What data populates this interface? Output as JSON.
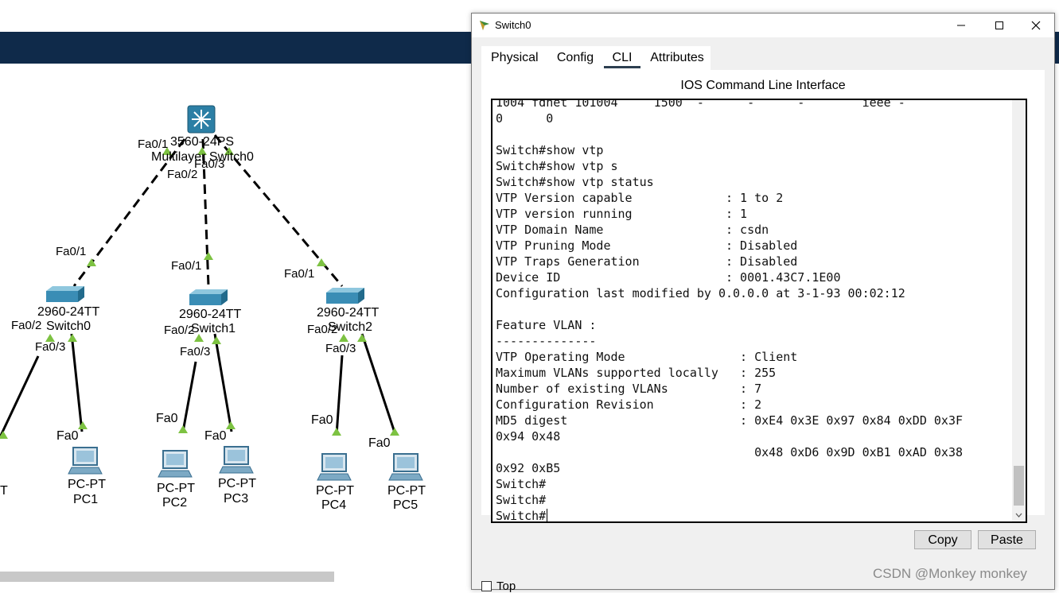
{
  "topology": {
    "multilayer": {
      "model": "3560-24PS",
      "name": "Multilayer Switch0"
    },
    "mls_ports": [
      "Fa0/1",
      "Fa0/2",
      "Fa0/3"
    ],
    "switches": [
      {
        "model": "2960-24TT",
        "name": "Switch0",
        "up": "Fa0/1",
        "p2": "Fa0/2",
        "p3": "Fa0/3"
      },
      {
        "model": "2960-24TT",
        "name": "Switch1",
        "up": "Fa0/1",
        "p2": "Fa0/2",
        "p3": "Fa0/3"
      },
      {
        "model": "2960-24TT",
        "name": "Switch2",
        "up": "Fa0/1",
        "p2": "Fa0/2",
        "p3": "Fa0/3"
      }
    ],
    "pcs": [
      {
        "model": "PC-PT",
        "name": "PC1",
        "port": "Fa0"
      },
      {
        "model": "PC-PT",
        "name": "PC2",
        "port": "Fa0"
      },
      {
        "model": "PC-PT",
        "name": "PC3",
        "port": "Fa0"
      },
      {
        "model": "PC-PT",
        "name": "PC4",
        "port": "Fa0"
      },
      {
        "model": "PC-PT",
        "name": "PC5",
        "port": "Fa0"
      }
    ],
    "cut_label": "T",
    "colors": {
      "link": "#000000",
      "port_dot": "#7dc242",
      "banner": "#0f2a4a",
      "device": "#2c7fa5"
    }
  },
  "window": {
    "title": "Switch0",
    "tabs": [
      {
        "label": "Physical"
      },
      {
        "label": "Config"
      },
      {
        "label": "CLI",
        "active": true
      },
      {
        "label": "Attributes"
      }
    ],
    "cli_heading": "IOS Command Line Interface",
    "terminal_lines": [
      "1004 fdnet 101004     1500  -      -      -        ieee -",
      "0      0",
      "",
      "Switch#show vtp",
      "Switch#show vtp s",
      "Switch#show vtp status",
      "VTP Version capable             : 1 to 2",
      "VTP version running             : 1",
      "VTP Domain Name                 : csdn",
      "VTP Pruning Mode                : Disabled",
      "VTP Traps Generation            : Disabled",
      "Device ID                       : 0001.43C7.1E00",
      "Configuration last modified by 0.0.0.0 at 3-1-93 00:02:12",
      "",
      "Feature VLAN :",
      "--------------",
      "VTP Operating Mode                : Client",
      "Maximum VLANs supported locally   : 255",
      "Number of existing VLANs          : 7",
      "Configuration Revision            : 2",
      "MD5 digest                        : 0xE4 0x3E 0x97 0x84 0xDD 0x3F",
      "0x94 0x48",
      "                                    0x48 0xD6 0x9D 0xB1 0xAD 0x38",
      "0x92 0xB5",
      "Switch#",
      "Switch#",
      "Switch#"
    ],
    "copy_label": "Copy",
    "paste_label": "Paste",
    "top_label": "Top"
  },
  "watermark": "CSDN @Monkey monkey"
}
